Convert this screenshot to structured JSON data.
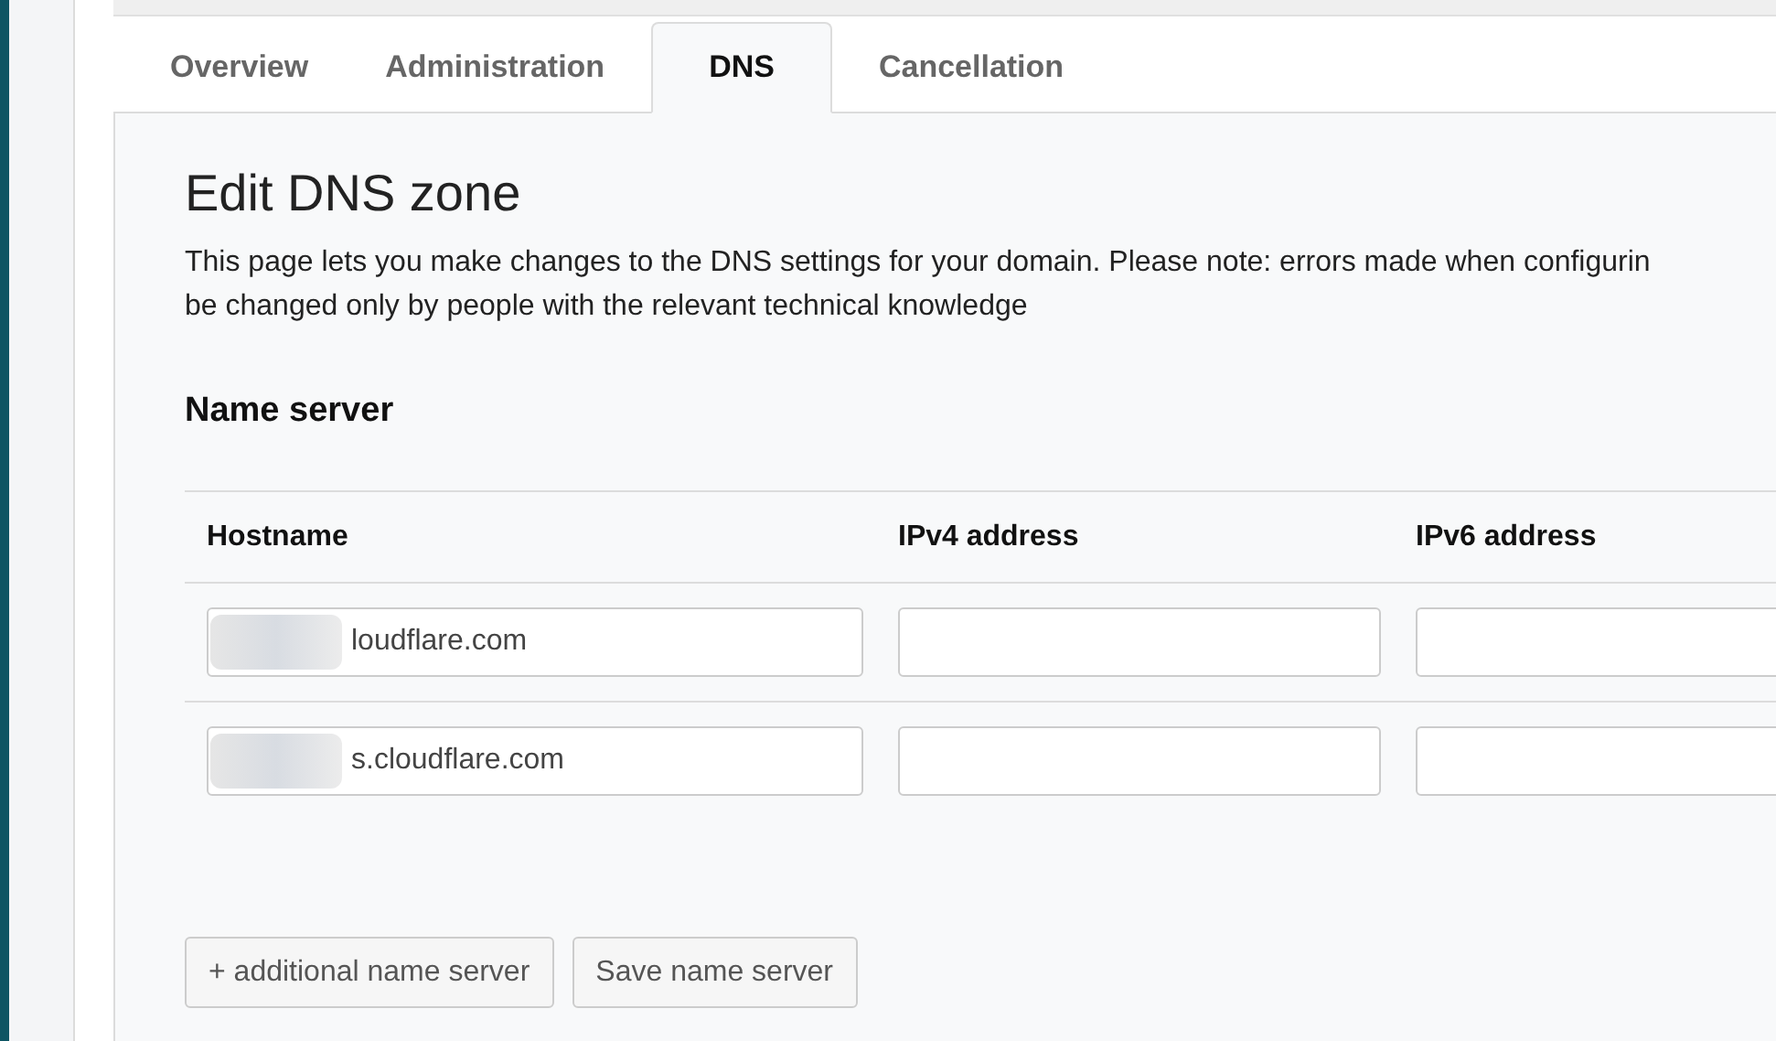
{
  "tabs": [
    {
      "label": "Overview",
      "selected": false
    },
    {
      "label": "Administration",
      "selected": false
    },
    {
      "label": "DNS",
      "selected": true
    },
    {
      "label": "Cancellation",
      "selected": false
    }
  ],
  "heading": "Edit DNS zone",
  "description": "This page lets you make changes to the DNS settings for your domain. Please note: errors made when configurin\nbe changed only by people with the relevant technical knowledge",
  "section_title": "Name server",
  "table": {
    "columns": [
      "Hostname",
      "IPv4 address",
      "IPv6 address"
    ],
    "rows": [
      {
        "hostname": "loudflare.com",
        "ipv4": "",
        "ipv6": ""
      },
      {
        "hostname": "s.cloudflare.com",
        "ipv4": "",
        "ipv6": ""
      }
    ]
  },
  "buttons": [
    "+ additional name server",
    "Save name server"
  ]
}
